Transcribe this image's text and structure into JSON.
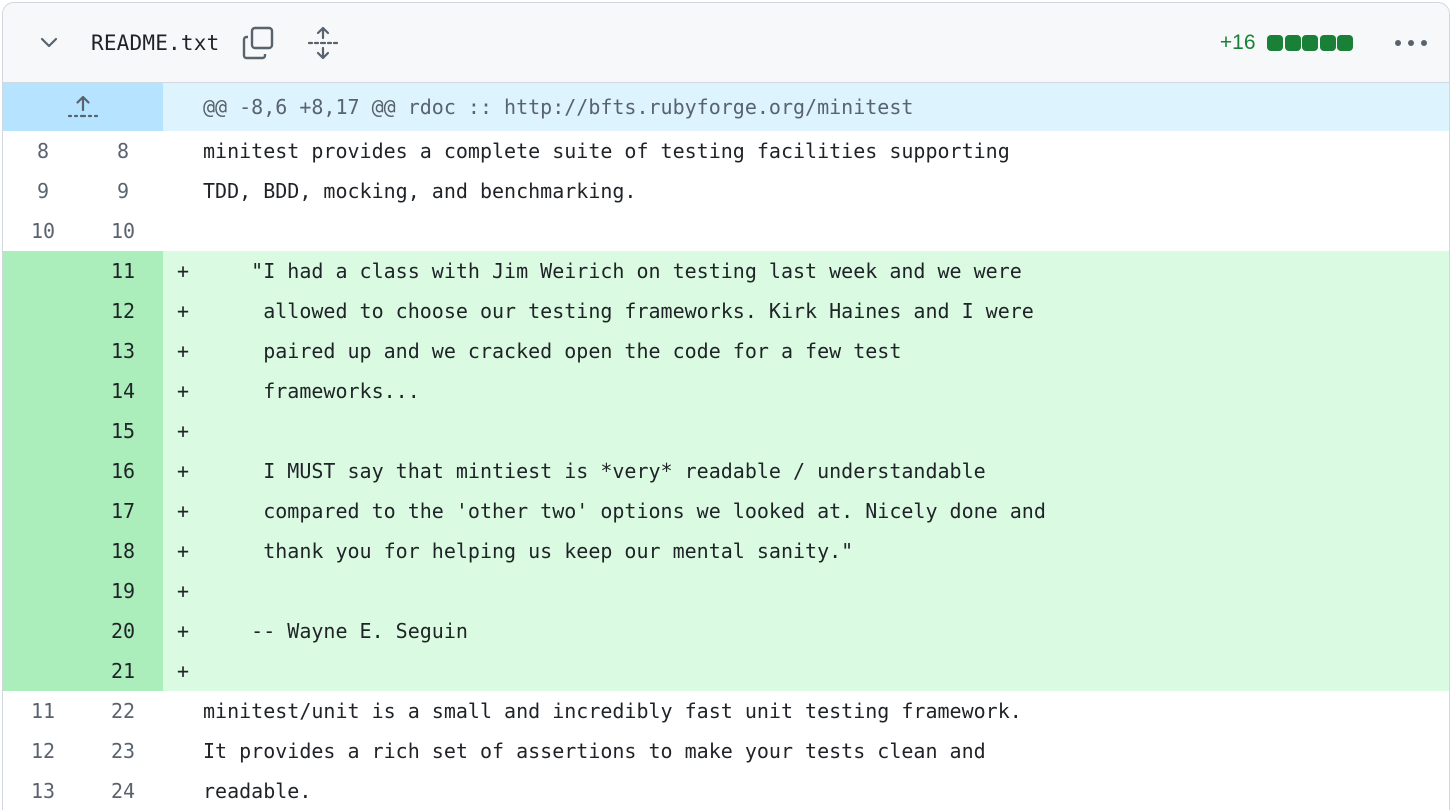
{
  "file": {
    "name": "README.txt",
    "additions": "+16",
    "diffstat_colors": [
      "#1a7f37",
      "#1a7f37",
      "#1a7f37",
      "#1a7f37",
      "#1a7f37"
    ]
  },
  "hunk": {
    "header": "@@ -8,6 +8,17 @@ rdoc :: http://bfts.rubyforge.org/minitest"
  },
  "lines": [
    {
      "type": "context",
      "old": "8",
      "new": "8",
      "marker": "",
      "text": "minitest provides a complete suite of testing facilities supporting"
    },
    {
      "type": "context",
      "old": "9",
      "new": "9",
      "marker": "",
      "text": "TDD, BDD, mocking, and benchmarking."
    },
    {
      "type": "context",
      "old": "10",
      "new": "10",
      "marker": "",
      "text": ""
    },
    {
      "type": "add",
      "old": "",
      "new": "11",
      "marker": "+",
      "text": "    \"I had a class with Jim Weirich on testing last week and we were"
    },
    {
      "type": "add",
      "old": "",
      "new": "12",
      "marker": "+",
      "text": "     allowed to choose our testing frameworks. Kirk Haines and I were"
    },
    {
      "type": "add",
      "old": "",
      "new": "13",
      "marker": "+",
      "text": "     paired up and we cracked open the code for a few test"
    },
    {
      "type": "add",
      "old": "",
      "new": "14",
      "marker": "+",
      "text": "     frameworks..."
    },
    {
      "type": "add",
      "old": "",
      "new": "15",
      "marker": "+",
      "text": ""
    },
    {
      "type": "add",
      "old": "",
      "new": "16",
      "marker": "+",
      "text": "     I MUST say that mintiest is *very* readable / understandable"
    },
    {
      "type": "add",
      "old": "",
      "new": "17",
      "marker": "+",
      "text": "     compared to the 'other two' options we looked at. Nicely done and"
    },
    {
      "type": "add",
      "old": "",
      "new": "18",
      "marker": "+",
      "text": "     thank you for helping us keep our mental sanity.\""
    },
    {
      "type": "add",
      "old": "",
      "new": "19",
      "marker": "+",
      "text": ""
    },
    {
      "type": "add",
      "old": "",
      "new": "20",
      "marker": "+",
      "text": "    -- Wayne E. Seguin"
    },
    {
      "type": "add",
      "old": "",
      "new": "21",
      "marker": "+",
      "text": ""
    },
    {
      "type": "context",
      "old": "11",
      "new": "22",
      "marker": "",
      "text": "minitest/unit is a small and incredibly fast unit testing framework."
    },
    {
      "type": "context",
      "old": "12",
      "new": "23",
      "marker": "",
      "text": "It provides a rich set of assertions to make your tests clean and"
    },
    {
      "type": "context",
      "old": "13",
      "new": "24",
      "marker": "",
      "text": "readable."
    }
  ],
  "icons": {
    "collapse": "chevron-down-icon",
    "copy": "copy-icon",
    "expand_all": "unfold-icon",
    "expand_up": "fold-up-icon",
    "more": "kebab-horizontal-icon"
  }
}
